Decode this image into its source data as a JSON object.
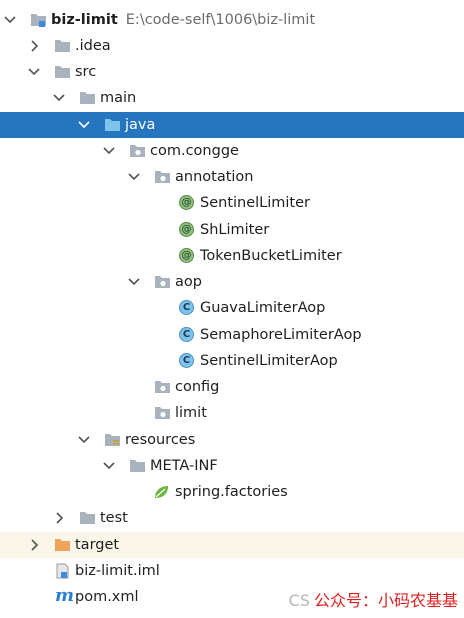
{
  "tree": {
    "root": {
      "name": "biz-limit",
      "path": "E:\\code-self\\1006\\biz-limit"
    },
    "idea": "idea",
    "src": "src",
    "main": "main",
    "java": "java",
    "package": "com.congge",
    "annotation": "annotation",
    "annotations": [
      "SentinelLimiter",
      "ShLimiter",
      "TokenBucketLimiter"
    ],
    "aop": "aop",
    "aop_classes": [
      "GuavaLimiterAop",
      "SemaphoreLimiterAop",
      "SentinelLimiterAop"
    ],
    "config": "config",
    "limit": "limit",
    "resources": "resources",
    "meta_inf": "META-INF",
    "spring_factories": "spring.factories",
    "test": "test",
    "target": "target",
    "iml": "biz-limit.iml",
    "pom": "pom.xml"
  },
  "badges": {
    "annotation": "@",
    "class": "C",
    "maven": "m"
  },
  "colors": {
    "selection": "#2675bf",
    "folder": "#a9b3bd",
    "target_folder": "#f0a35b",
    "annotation_badge": "#8ec07c",
    "class_badge": "#7ec3ea"
  },
  "watermark": {
    "csdn": "CS",
    "text": "公众号：小码农基基"
  }
}
